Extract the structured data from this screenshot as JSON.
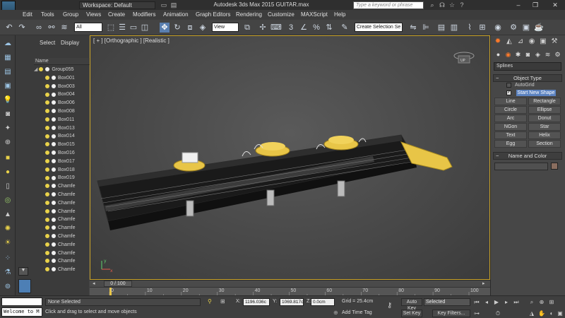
{
  "window": {
    "app_logo": "MAX",
    "title": "Autodesk 3ds Max  2015      GUITAR.max",
    "workspace": "Workspace: Default",
    "search_placeholder": "Type a keyword or phrase"
  },
  "menu": [
    "Edit",
    "Tools",
    "Group",
    "Views",
    "Create",
    "Modifiers",
    "Animation",
    "Graph Editors",
    "Rendering",
    "Customize",
    "MAXScript",
    "Help"
  ],
  "toolbar": {
    "selection_filter": "All",
    "ref_coord": "View",
    "named_selection": "Create Selection Se"
  },
  "scene_explorer": {
    "tabs": [
      "Select",
      "Display"
    ],
    "column_header": "Name",
    "group": "Group055",
    "items": [
      "Box001",
      "Box003",
      "Box004",
      "Box006",
      "Box008",
      "Box011",
      "Box013",
      "Box014",
      "Box015",
      "Box016",
      "Box017",
      "Box018",
      "Box019",
      "Chamfe",
      "Chamfe",
      "Chamfe",
      "Chamfe",
      "Chamfe",
      "Chamfe",
      "Chamfe",
      "Chamfe",
      "Chamfe",
      "Chamfe",
      "Chamfe"
    ]
  },
  "viewport": {
    "label": "[ + ] [Orthographic ] [Realistic ]",
    "viewcube_label": "UP",
    "axis_y": "y",
    "axis_x": "x"
  },
  "command_panel": {
    "category": "Splines",
    "object_type_title": "Object Type",
    "autogrid": "AutoGrid",
    "start_new_shape": "Start New Shape",
    "shapes": [
      "Line",
      "Rectangle",
      "Circle",
      "Ellipse",
      "Arc",
      "Donut",
      "NGon",
      "Star",
      "Text",
      "Helix",
      "Egg",
      "Section"
    ],
    "name_color_title": "Name and Color"
  },
  "timeline": {
    "frame": "0 / 100",
    "ticks": [
      "0",
      "10",
      "20",
      "30",
      "40",
      "50",
      "60",
      "70",
      "80",
      "90",
      "100"
    ]
  },
  "status": {
    "maxscript_text": "Welcome to M",
    "selection": "None Selected",
    "prompt": "Click and drag to select and move objects",
    "x_label": "X:",
    "x_value": "1196.036c",
    "y_label": "Y:",
    "y_value": "1069.817c",
    "z_label": "Z:",
    "z_value": "0.0cm",
    "grid": "Grid = 25.4cm",
    "add_time_tag": "Add Time Tag",
    "auto_key": "Auto Key",
    "selected": "Selected",
    "set_key": "Set Key",
    "key_filters": "Key Filters..."
  },
  "colors": {
    "viewport_border": "#c9a227",
    "active_tool": "#5a7fb0",
    "start_shape": "#5b82c0",
    "command_tab_active": "#ff7a2a",
    "tuner_gold": "#e8c547",
    "neck_black": "#1a1a1a"
  }
}
